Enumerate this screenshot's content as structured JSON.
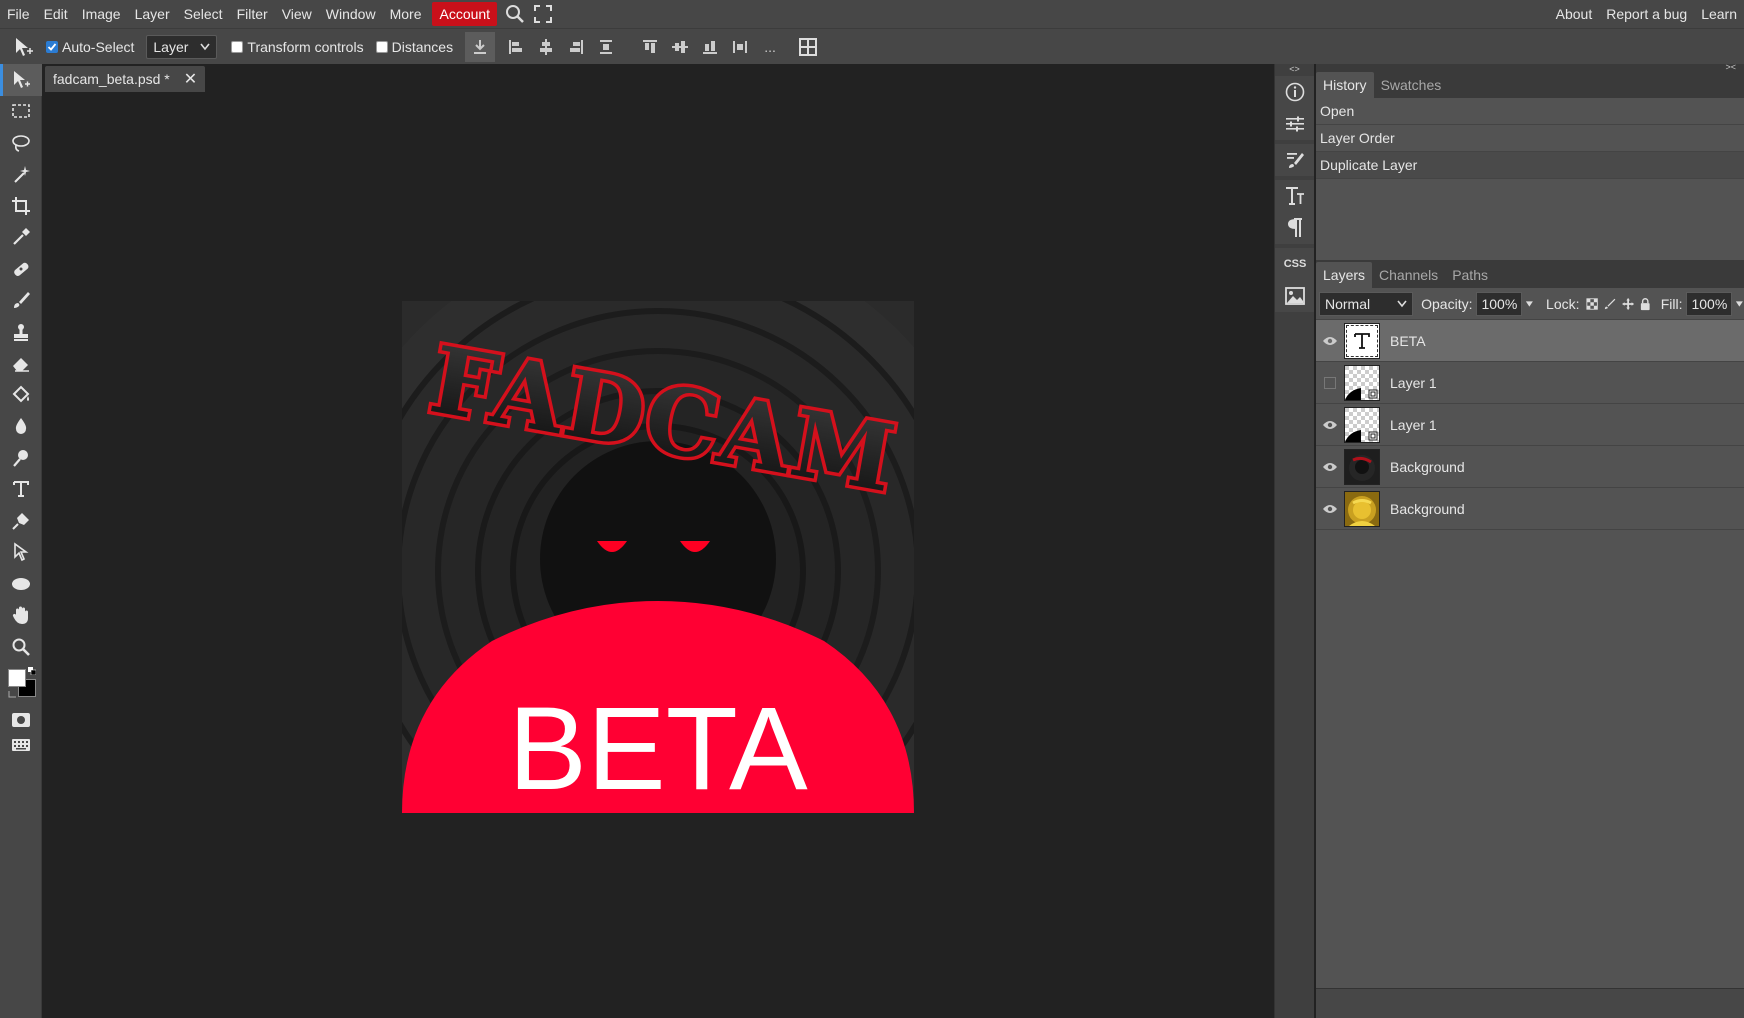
{
  "menu": {
    "items": [
      "File",
      "Edit",
      "Image",
      "Layer",
      "Select",
      "Filter",
      "View",
      "Window",
      "More"
    ],
    "account": "Account",
    "right_items": [
      "About",
      "Report a bug",
      "Learn"
    ]
  },
  "options": {
    "auto_select_label": "Auto-Select",
    "auto_select_checked": true,
    "target_value": "Layer",
    "transform_controls_label": "Transform controls",
    "distances_label": "Distances",
    "more": "..."
  },
  "document": {
    "tab_title": "fadcam_beta.psd *",
    "close": "✕"
  },
  "artwork": {
    "logo_text": "FADCAM",
    "badge_text": "BETA",
    "colors": {
      "red": "#ff0033",
      "dark": "#1b1b1b",
      "rings": "#2a2a2a"
    }
  },
  "history": {
    "tabs": [
      "History",
      "Swatches"
    ],
    "items": [
      "Open",
      "Layer Order",
      "Duplicate Layer"
    ]
  },
  "layers": {
    "tabs": [
      "Layers",
      "Channels",
      "Paths"
    ],
    "blend_mode": "Normal",
    "opacity_label": "Opacity:",
    "opacity_value": "100%",
    "lock_label": "Lock:",
    "fill_label": "Fill:",
    "fill_value": "100%",
    "items": [
      {
        "name": "BETA",
        "visible": true,
        "type": "text",
        "selected": true
      },
      {
        "name": "Layer 1",
        "visible": false,
        "type": "smart"
      },
      {
        "name": "Layer 1",
        "visible": true,
        "type": "smart"
      },
      {
        "name": "Background",
        "visible": true,
        "type": "dark"
      },
      {
        "name": "Background",
        "visible": true,
        "type": "gold"
      }
    ]
  },
  "minibar": {
    "css_label": "CSS",
    "collapse_left": "<>",
    "collapse_right": "><"
  }
}
